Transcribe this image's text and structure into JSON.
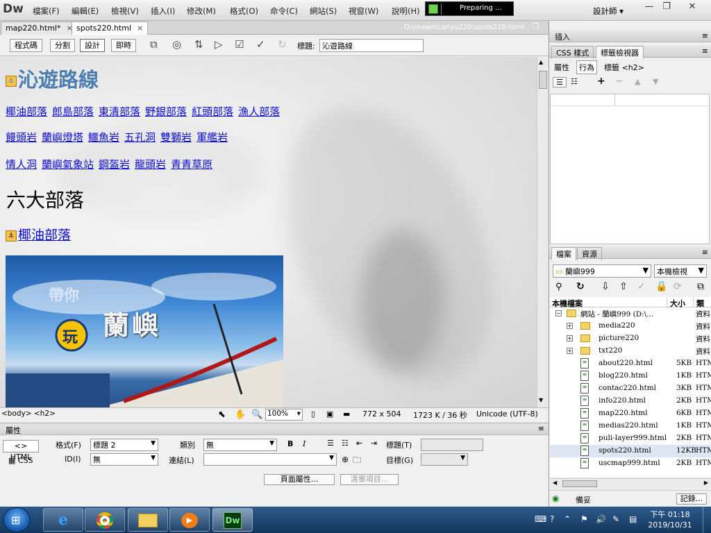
{
  "app": {
    "logo": "Dw",
    "menus": [
      "檔案(F)",
      "編輯(E)",
      "檢視(V)",
      "插入(I)",
      "修改(M)",
      "格式(O)",
      "命令(C)",
      "網站(S)",
      "視窗(W)",
      "說明(H)"
    ],
    "progress_text": "Preparing ...",
    "workspace": "設計師",
    "win_min": "—",
    "win_max": "❐",
    "win_close": "✕"
  },
  "doc_tabs": [
    {
      "label": "map220.html*",
      "close": "×"
    },
    {
      "label": "spots220.html",
      "close": "×"
    }
  ],
  "doc_path": "D:\\mawn\\Lanyu220\\spots220.html",
  "view_buttons": [
    "程式碼",
    "分割",
    "設計",
    "即時"
  ],
  "page_title_label": "標題:",
  "page_title_value": "沁遊路線",
  "design": {
    "heading": "沁遊路線",
    "anchor_glyph": "⚓",
    "links_row1": [
      "椰油部落",
      "郎島部落",
      "東清部落",
      "野銀部落",
      "紅頭部落",
      "漁人部落"
    ],
    "links_row2": [
      "饅頭岩",
      "蘭嶼燈塔",
      "鱷魚岩",
      "五孔洞",
      "雙獅岩",
      "軍艦岩"
    ],
    "links_row3": [
      "情人洞",
      "蘭嶼氣象站",
      "鋼盔岩",
      "龍頭岩",
      "青青草原"
    ],
    "section_heading": "六大部落",
    "sub_heading": "椰油部落",
    "banner_text": {
      "small": "帶你",
      "circle": "玩",
      "big": "蘭嶼"
    }
  },
  "status": {
    "tags": "<body> <h2>",
    "zoom": "100%",
    "size": "772 x 504",
    "file": "1723 K / 36 秒",
    "encoding": "Unicode (UTF-8)"
  },
  "props": {
    "header": "屬性",
    "html_btn": "HTML",
    "css_btn": "CSS",
    "format_label": "格式(F)",
    "format_value": "標題 2",
    "id_label": "ID(I)",
    "id_value": "無",
    "class_label": "類別",
    "class_value": "無",
    "link_label": "連結(L)",
    "link_value": "",
    "bold": "B",
    "italic": "I",
    "title_label": "標題(T)",
    "target_label": "目標(G)",
    "page_props_btn": "頁面屬性...",
    "list_item_btn": "清單項目..."
  },
  "right": {
    "insert_tab": "插入",
    "css_tab": "CSS 樣式",
    "tag_inspector_tab": "標籤檢視器",
    "attr_tab": "屬性",
    "behavior_tab": "行為",
    "tag_label": "標籤 <h2>",
    "files_tab": "檔案",
    "assets_tab": "資源",
    "site_select": "蘭嶼999",
    "view_select": "本機檢視",
    "col_local": "本機檔案",
    "col_size": "大小",
    "col_type": "類型",
    "files": [
      {
        "name": "網站 - 蘭嶼999 (D:\\...",
        "size": "",
        "type": "資料",
        "kind": "root"
      },
      {
        "name": "media220",
        "size": "",
        "type": "資料",
        "kind": "folder"
      },
      {
        "name": "picture220",
        "size": "",
        "type": "資料",
        "kind": "folder"
      },
      {
        "name": "txt220",
        "size": "",
        "type": "資料",
        "kind": "folder"
      },
      {
        "name": "about220.html",
        "size": "5KB",
        "type": "HTM",
        "kind": "file"
      },
      {
        "name": "blog220.html",
        "size": "1KB",
        "type": "HTM",
        "kind": "file"
      },
      {
        "name": "contac220.html",
        "size": "3KB",
        "type": "HTM",
        "kind": "file"
      },
      {
        "name": "info220.html",
        "size": "2KB",
        "type": "HTM",
        "kind": "file"
      },
      {
        "name": "map220.html",
        "size": "6KB",
        "type": "HTM",
        "kind": "file"
      },
      {
        "name": "medias220.html",
        "size": "1KB",
        "type": "HTM",
        "kind": "file"
      },
      {
        "name": "puli-layer999.html",
        "size": "2KB",
        "type": "HTM",
        "kind": "file"
      },
      {
        "name": "spots220.html",
        "size": "12KB",
        "type": "HTM",
        "kind": "file",
        "selected": true
      },
      {
        "name": "uscmap999.html",
        "size": "2KB",
        "type": "HTM",
        "kind": "file"
      }
    ],
    "footer_status": "備妥",
    "log_btn": "記錄..."
  },
  "taskbar": {
    "time_prefix": "下午",
    "time": "01:18",
    "date": "2019/10/31"
  }
}
